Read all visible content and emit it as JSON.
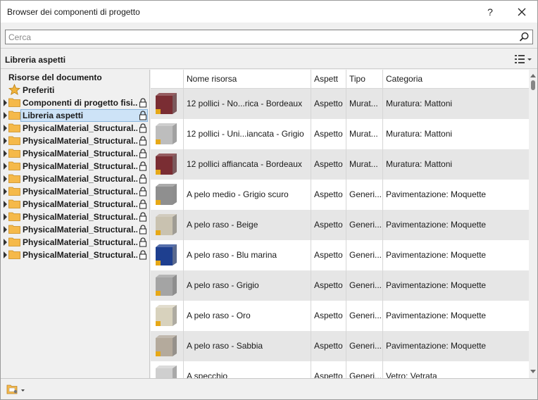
{
  "window": {
    "title": "Browser dei componenti di progetto",
    "help_label": "?",
    "close_label": "✕"
  },
  "search": {
    "placeholder": "Cerca",
    "value": ""
  },
  "library": {
    "title": "Libreria aspetti"
  },
  "tree": {
    "root_label": "Risorse del documento",
    "items": [
      {
        "label": "Preferiti",
        "type": "favorites"
      },
      {
        "label": "Componenti di progetto fisi...",
        "type": "folder",
        "locked": true
      },
      {
        "label": "Libreria aspetti",
        "type": "folder",
        "locked": true,
        "selected": true
      },
      {
        "label": "PhysicalMaterial_Structural...",
        "type": "folder",
        "locked": true
      },
      {
        "label": "PhysicalMaterial_Structural...",
        "type": "folder",
        "locked": true
      },
      {
        "label": "PhysicalMaterial_Structural...",
        "type": "folder",
        "locked": true
      },
      {
        "label": "PhysicalMaterial_Structural...",
        "type": "folder",
        "locked": true
      },
      {
        "label": "PhysicalMaterial_Structural...",
        "type": "folder",
        "locked": true
      },
      {
        "label": "PhysicalMaterial_Structural...",
        "type": "folder",
        "locked": true
      },
      {
        "label": "PhysicalMaterial_Structural...",
        "type": "folder",
        "locked": true
      },
      {
        "label": "PhysicalMaterial_Structural...",
        "type": "folder",
        "locked": true
      },
      {
        "label": "PhysicalMaterial_Structural...",
        "type": "folder",
        "locked": true
      },
      {
        "label": "PhysicalMaterial_Structural...",
        "type": "folder",
        "locked": true
      },
      {
        "label": "PhysicalMaterial_Structural...",
        "type": "folder",
        "locked": true
      }
    ]
  },
  "grid": {
    "columns": [
      "",
      "Nome risorsa",
      "Aspett",
      "Tipo",
      "Categoria"
    ],
    "rows": [
      {
        "name": "12 pollici - No...rica - Bordeaux",
        "aspect": "Aspetto",
        "type": "Murat...",
        "category": "Muratura: Mattoni",
        "swatch": "#7a2d33",
        "icon": "brick-swatch-icon"
      },
      {
        "name": "12 pollici - Uni...iancata - Grigio",
        "aspect": "Aspetto",
        "type": "Murat...",
        "category": "Muratura: Mattoni",
        "swatch": "#bdbdbd",
        "icon": "brick-swatch-icon"
      },
      {
        "name": "12 pollici affiancata - Bordeaux",
        "aspect": "Aspetto",
        "type": "Murat...",
        "category": "Muratura: Mattoni",
        "swatch": "#7a2d33",
        "icon": "brick-swatch-icon"
      },
      {
        "name": "A pelo medio - Grigio scuro",
        "aspect": "Aspetto",
        "type": "Generi...",
        "category": "Pavimentazione: Moquette",
        "swatch": "#8f8f8f",
        "icon": "carpet-swatch-icon"
      },
      {
        "name": "A pelo raso - Beige",
        "aspect": "Aspetto",
        "type": "Generi...",
        "category": "Pavimentazione: Moquette",
        "swatch": "#c9c2b0",
        "icon": "carpet-swatch-icon"
      },
      {
        "name": "A pelo raso - Blu marina",
        "aspect": "Aspetto",
        "type": "Generi...",
        "category": "Pavimentazione: Moquette",
        "swatch": "#1e3f8f",
        "icon": "carpet-swatch-icon"
      },
      {
        "name": "A pelo raso - Grigio",
        "aspect": "Aspetto",
        "type": "Generi...",
        "category": "Pavimentazione: Moquette",
        "swatch": "#a4a4a4",
        "icon": "carpet-swatch-icon"
      },
      {
        "name": "A pelo raso - Oro",
        "aspect": "Aspetto",
        "type": "Generi...",
        "category": "Pavimentazione: Moquette",
        "swatch": "#d8d2bd",
        "icon": "carpet-swatch-icon"
      },
      {
        "name": "A pelo raso - Sabbia",
        "aspect": "Aspetto",
        "type": "Generi...",
        "category": "Pavimentazione: Moquette",
        "swatch": "#b4aa9c",
        "icon": "carpet-swatch-icon"
      },
      {
        "name": "A specchio",
        "aspect": "Aspetto",
        "type": "Generi...",
        "category": "Vetro: Vetrata",
        "swatch": "#cfcfcf",
        "icon": "glass-swatch-icon"
      }
    ]
  },
  "colors": {
    "selection_fill": "#cde3f7",
    "selection_border": "#8ab5de",
    "alt_row": "#e6e6e6",
    "folder": "#f5b94a",
    "star": "#f0b23b",
    "lock_badge": "#e6a817"
  }
}
